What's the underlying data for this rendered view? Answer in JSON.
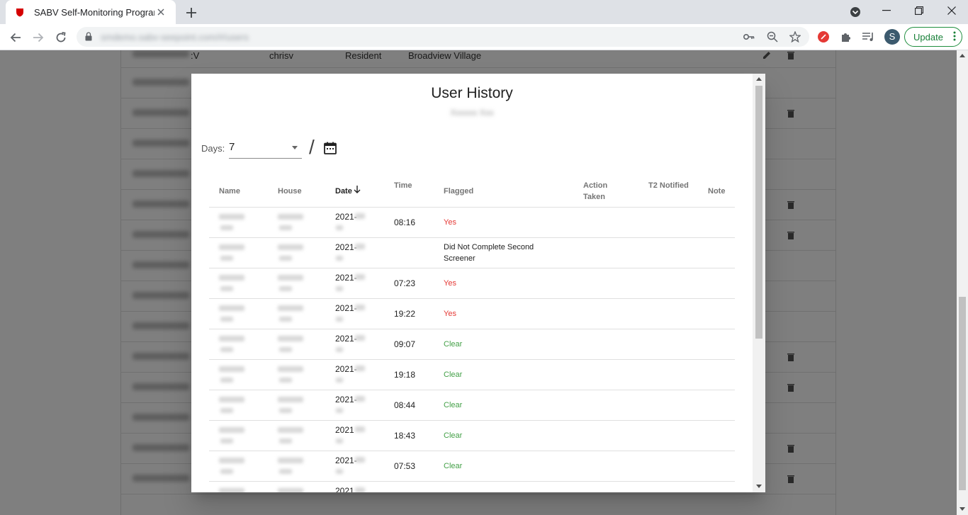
{
  "browser": {
    "tab_title": "SABV Self-Monitoring Program",
    "url": "smdemo.sabv-seepoint.com/#/users",
    "update_label": "Update",
    "profile_initial": "S",
    "accent_color": "#188038"
  },
  "background_table": {
    "first_row": {
      "name": "Xxxxxxxxx",
      "suffix": ":V",
      "username": "chrisv",
      "role": "Resident",
      "house": "Broadview Village"
    }
  },
  "dialog": {
    "title": "User History",
    "subtitle": "Xxxxxx Xxx",
    "days_label": "Days:",
    "days_value": "7",
    "separator": "/",
    "columns": {
      "name": "Name",
      "house": "House",
      "date": "Date",
      "time": "Time",
      "flagged": "Flagged",
      "action_taken": "Action Taken",
      "t2_notified": "T2 Notified",
      "note": "Note"
    },
    "rows": [
      {
        "date": "2021-",
        "time": "08:16",
        "flagged": "Yes",
        "status": "yes"
      },
      {
        "date": "2021-",
        "time": "",
        "flagged": "Did Not Complete Second Screener",
        "status": "text"
      },
      {
        "date": "2021-",
        "time": "07:23",
        "flagged": "Yes",
        "status": "yes"
      },
      {
        "date": "2021-",
        "time": "19:22",
        "flagged": "Yes",
        "status": "yes"
      },
      {
        "date": "2021-",
        "time": "09:07",
        "flagged": "Clear",
        "status": "clear"
      },
      {
        "date": "2021-",
        "time": "19:18",
        "flagged": "Clear",
        "status": "clear"
      },
      {
        "date": "2021-",
        "time": "08:44",
        "flagged": "Clear",
        "status": "clear"
      },
      {
        "date": "2021",
        "time": "18:43",
        "flagged": "Clear",
        "status": "clear"
      },
      {
        "date": "2021-",
        "time": "07:53",
        "flagged": "Clear",
        "status": "clear"
      },
      {
        "date": "2021",
        "time": "",
        "flagged": "",
        "status": "text"
      }
    ],
    "colors": {
      "yes": "#e53935",
      "clear": "#43a047"
    }
  }
}
